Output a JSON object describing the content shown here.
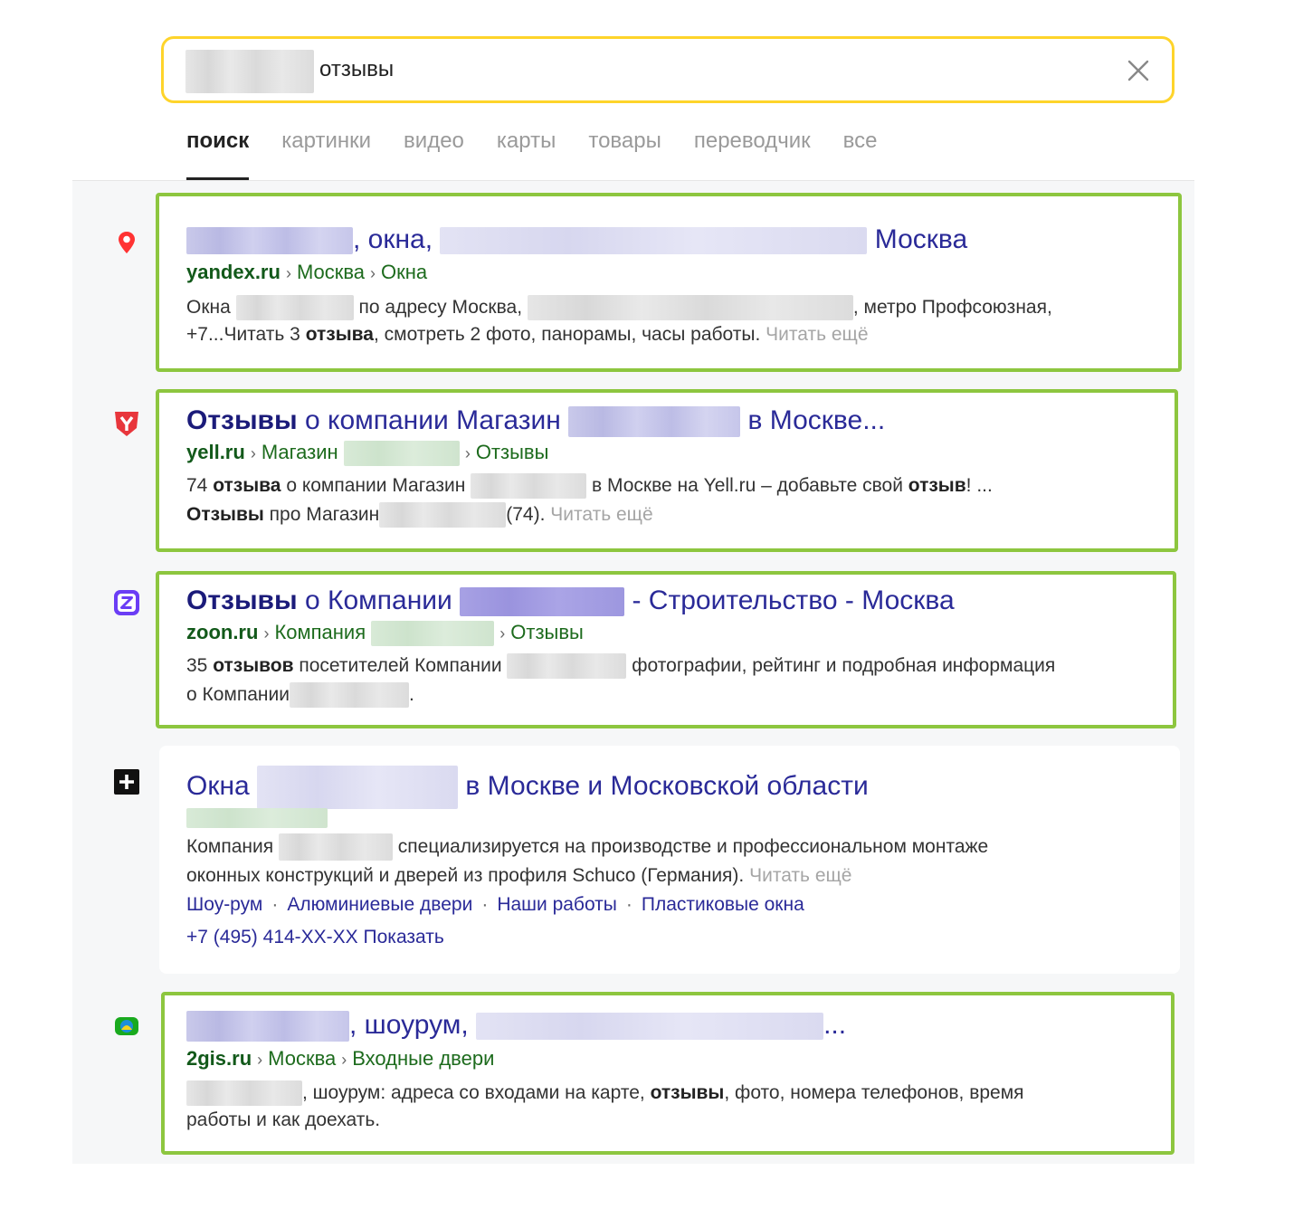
{
  "search": {
    "query": "отзывы"
  },
  "tabs": [
    {
      "label": "поиск",
      "active": true
    },
    {
      "label": "картинки"
    },
    {
      "label": "видео"
    },
    {
      "label": "карты"
    },
    {
      "label": "товары"
    },
    {
      "label": "переводчик"
    },
    {
      "label": "все"
    }
  ],
  "results": [
    {
      "icon": "map-pin-icon",
      "title_a": ", окна,",
      "title_b": "Москва",
      "path": {
        "domain": "yandex.ru",
        "crumbs": [
          "Москва",
          "Окна"
        ]
      },
      "snippet": {
        "l1_a": "Окна",
        "l1_b": "по адресу Москва,",
        "l1_c": ", метро Профсоюзная,",
        "l2_a": "+7...Читать 3",
        "l2_bold": "отзыва",
        "l2_b": ", смотреть 2 фото, панорамы, часы работы.",
        "more": "Читать ещё"
      }
    },
    {
      "icon": "yell-logo-icon",
      "title_bold": "Отзывы",
      "title_a": " о компании Магазин",
      "title_b": "в Москве...",
      "path": {
        "domain": "yell.ru",
        "crumb1": "Магазин",
        "crumb2": "Отзывы"
      },
      "snippet": {
        "l1_a": "74",
        "l1_bold1": "отзыва",
        "l1_b": " о компании Магазин",
        "l1_c": "в Москве на Yell.ru – добавьте свой",
        "l1_bold2": "отзыв",
        "l1_d": "! ...",
        "l2_bold": "Отзывы",
        "l2_a": " про Магазин",
        "l2_b": "(74).",
        "more": "Читать ещё"
      }
    },
    {
      "icon": "zoon-logo-icon",
      "title_bold": "Отзывы",
      "title_a": " о Компании",
      "title_b": "- Строительство - Москва",
      "path": {
        "domain": "zoon.ru",
        "crumb1": "Компания",
        "crumb2": "Отзывы"
      },
      "snippet": {
        "l1_a": "35",
        "l1_bold": "отзывов",
        "l1_b": " посетителей Компании",
        "l1_c": "фотографии, рейтинг и подробная информация",
        "l2_a": "о Компании",
        "l2_b": "."
      }
    },
    {
      "icon": "plus-square-icon",
      "title_a": "Окна",
      "title_b": "в Москве и Московской области",
      "snippet": {
        "l1_a": "Компания",
        "l1_b": "специализируется на производстве и профессиональном монтаже",
        "l2_a": "оконных конструкций и дверей из профиля Schuco (Германия).",
        "more": "Читать ещё"
      },
      "sitelinks": [
        "Шоу-рум",
        "Алюминиевые двери",
        "Наши работы",
        "Пластиковые окна"
      ],
      "phone": "+7 (495) 414-XX-XX Показать"
    },
    {
      "icon": "2gis-logo-icon",
      "title_a": ", шоурум,",
      "title_b": "...",
      "path": {
        "domain": "2gis.ru",
        "crumbs": [
          "Москва",
          "Входные двери"
        ]
      },
      "snippet": {
        "l1_a": ", шоурум: адреса со входами на карте,",
        "l1_bold": "отзывы",
        "l1_b": ", фото, номера телефонов, время",
        "l2_a": "работы и как доехать."
      }
    }
  ],
  "colors": {
    "search_border": "#fed42b",
    "highlight_border": "#8dc63f",
    "link": "#2a2a98",
    "path": "#1d6b1d"
  }
}
